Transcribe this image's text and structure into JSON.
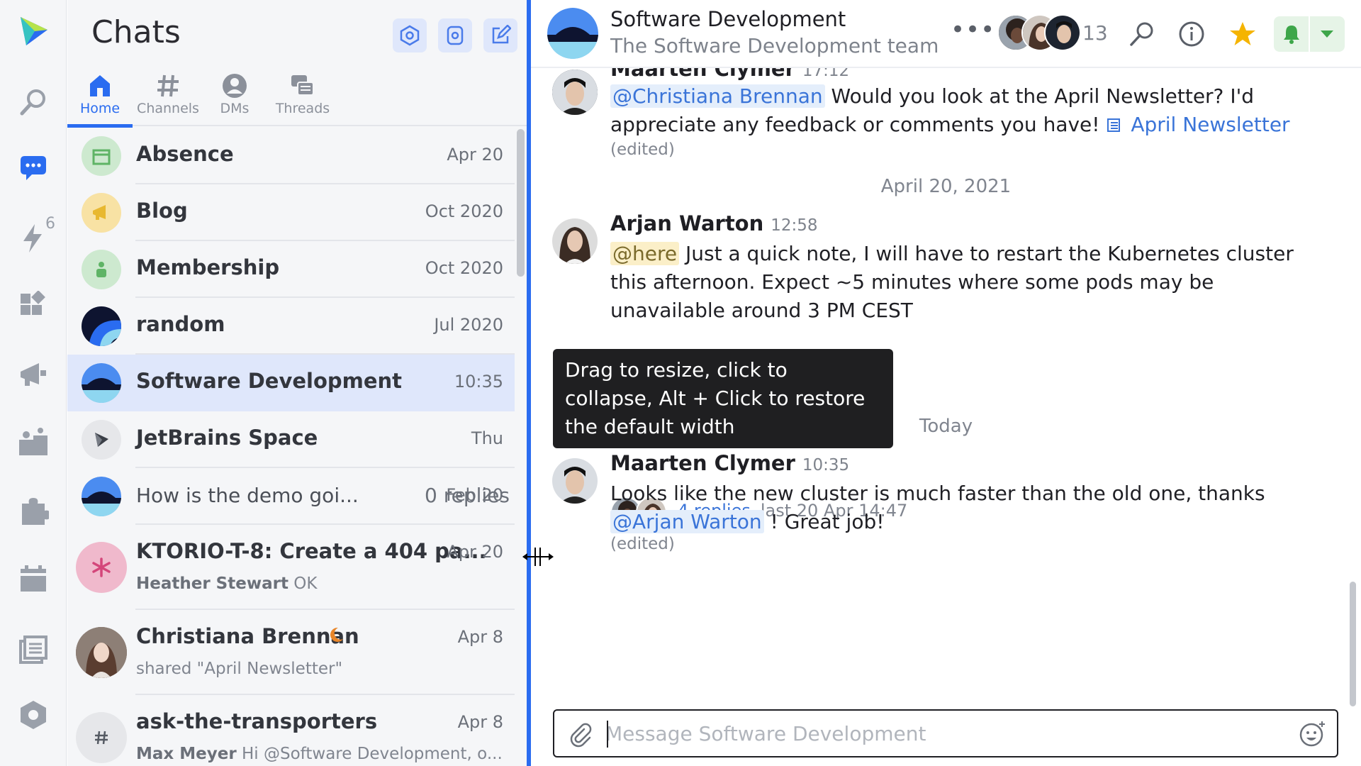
{
  "rail": {
    "items": [
      "app-logo",
      "search-icon",
      "chats-icon",
      "activity-icon",
      "dashboard-icon",
      "megaphone-icon",
      "team-icon",
      "puzzle-icon",
      "calendar-icon",
      "documents-icon",
      "settings-hex-icon"
    ],
    "activity_badge": "6"
  },
  "panel": {
    "title": "Chats",
    "tabs": [
      {
        "label": "Home",
        "icon": "home-icon"
      },
      {
        "label": "Channels",
        "icon": "hash-icon"
      },
      {
        "label": "DMs",
        "icon": "person-icon"
      },
      {
        "label": "Threads",
        "icon": "threads-icon"
      }
    ],
    "list": [
      {
        "name": "Absence",
        "date": "Apr 20"
      },
      {
        "name": "Blog",
        "date": "Oct 2020"
      },
      {
        "name": "Membership",
        "date": "Oct 2020"
      },
      {
        "name": "random",
        "date": "Jul 2020"
      },
      {
        "name": "Software Development",
        "date": "10:35"
      },
      {
        "name": "JetBrains Space",
        "date": "Thu"
      },
      {
        "text": "How is the demo goi...",
        "replies": "0 replies",
        "date": "Feb 20"
      },
      {
        "name": "KTORIO-T-8: Create a 404 pa...",
        "date": "Apr 20",
        "sub_author": "Heather Stewart",
        "sub_text": " OK"
      },
      {
        "name": "Christiana Brennan",
        "date": "Apr 8",
        "sub_text": "shared \"April Newsletter\""
      },
      {
        "name": "ask-the-transporters",
        "date": "Apr 8",
        "sub_author": "Max Meyer",
        "sub_text": " Hi @Software Development, o..."
      }
    ]
  },
  "chat": {
    "title": "Software Development",
    "subtitle": "The Software Development team",
    "more": "•••",
    "member_count": "13",
    "messages": [
      {
        "author": "Maarten Clymer",
        "time": "17:12",
        "mention": "@Christiana Brennan",
        "text": " Would you look at the April Newsletter? I'd appreciate any feedback or comments you have! ",
        "doc_link": "April Newsletter",
        "edited": "(edited)"
      },
      {
        "author": "Arjan Warton",
        "time": "12:58",
        "mention": "@here",
        "text": " Just a quick note, I will have to restart the Kubernetes cluster this afternoon. Expect ~5 minutes where some pods may be unavailable around 3 PM CEST",
        "replies": "4 replies",
        "last_reply": "last 20 Apr 14:47"
      },
      {
        "author": "Maarten Clymer",
        "time": "10:35",
        "text_before": "Looks like the new cluster is much faster than the old one, thanks ",
        "mention": "@Arjan Warton",
        "text_after": " ! Great job!",
        "edited": "(edited)"
      }
    ],
    "day_separators": [
      "April 20, 2021",
      "Today"
    ],
    "composer_placeholder": "Message Software Development"
  },
  "tooltip": {
    "text": "Drag to resize, click to collapse, Alt + Click to restore the default width"
  },
  "colors": {
    "accent": "#2a6cf0",
    "selected_row": "#dfe7fb",
    "star": "#f5b400",
    "notify_green": "#3ea64a"
  }
}
